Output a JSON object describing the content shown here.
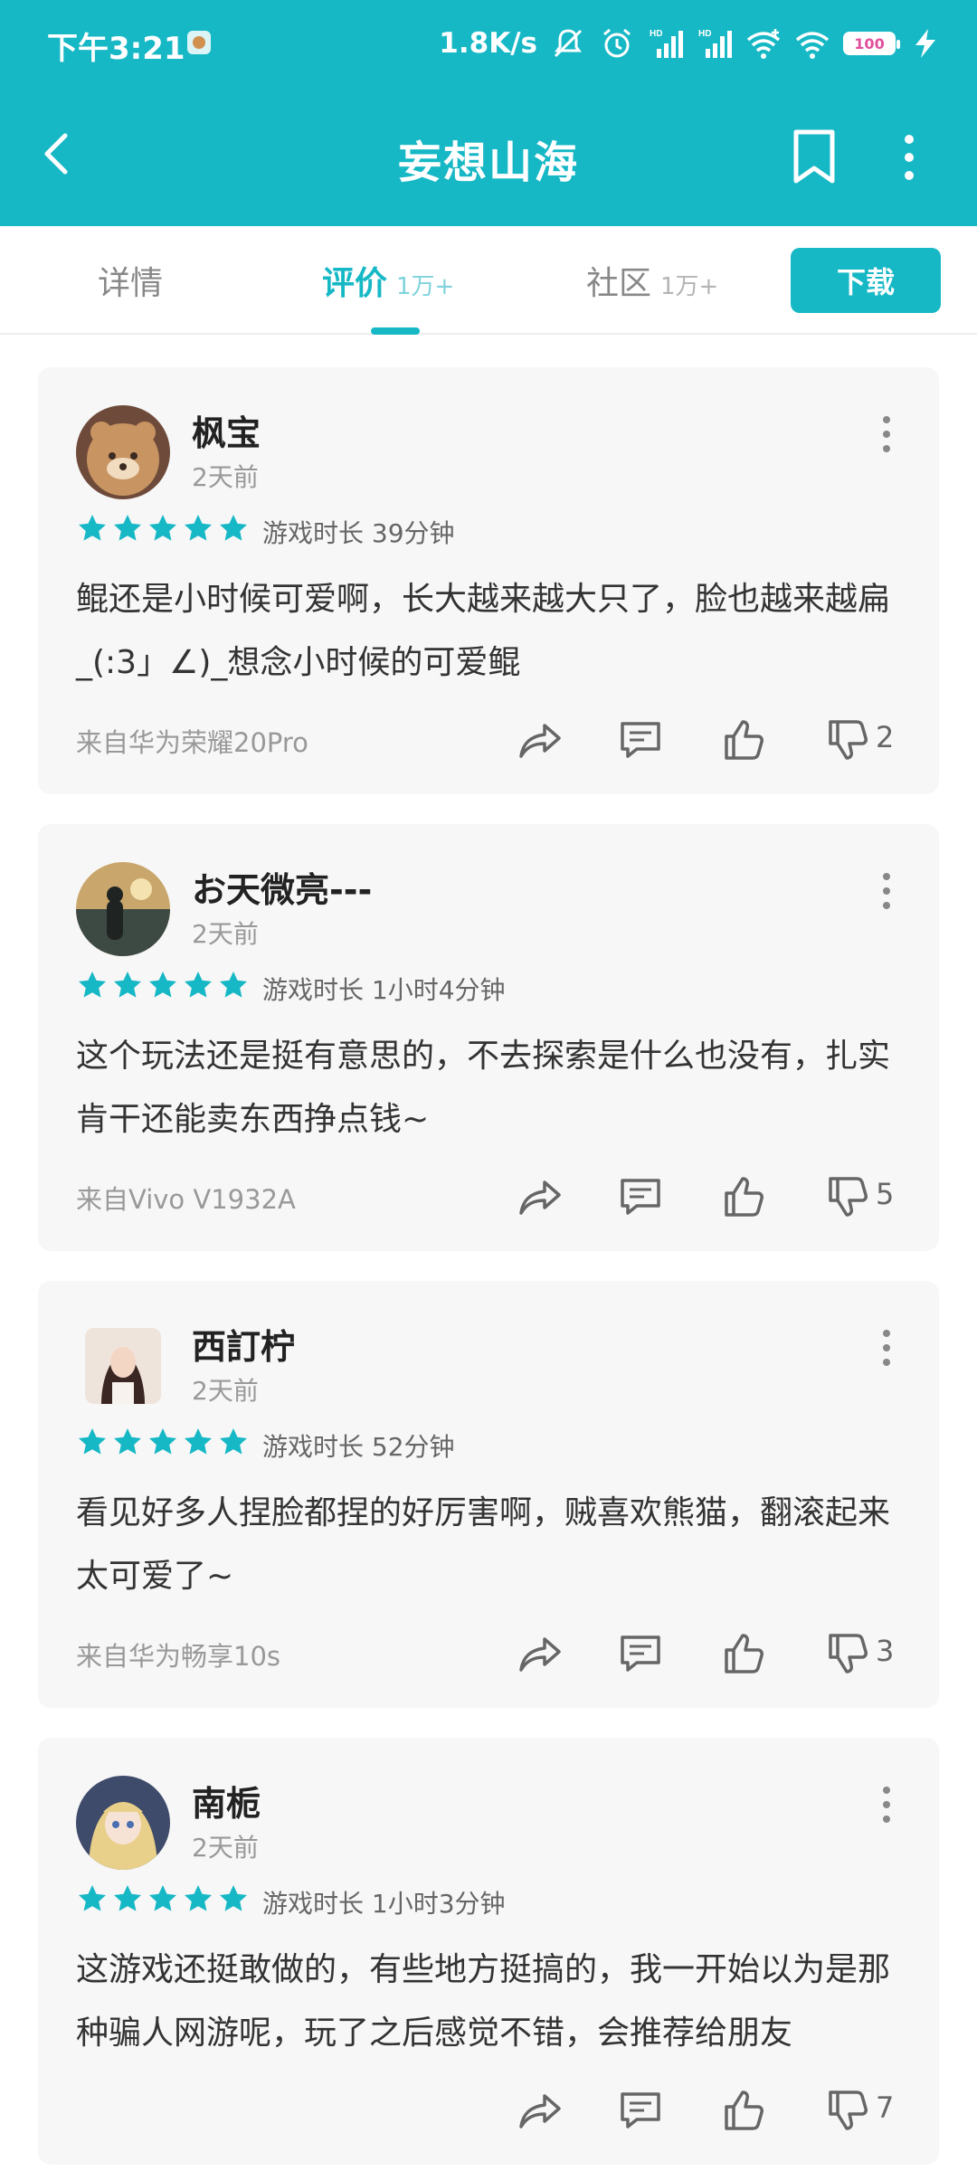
{
  "status_bar": {
    "time": "下午3:21",
    "net_speed": "1.8K/s",
    "battery": "100",
    "icons": [
      "mute-bell-icon",
      "alarm-icon",
      "hd-signal-icon",
      "hd-signal-icon",
      "wifi-plus-icon",
      "wifi-icon",
      "battery-icon",
      "charging-icon"
    ]
  },
  "header": {
    "title": "妄想山海",
    "icons": [
      "back-icon",
      "bookmark-icon",
      "more-vertical-icon"
    ]
  },
  "tabs": [
    {
      "label": "详情",
      "count": ""
    },
    {
      "label": "评价",
      "count": "1万+"
    },
    {
      "label": "社区",
      "count": "1万+"
    }
  ],
  "download_label": "下载",
  "colors": {
    "accent": "#17b8c6",
    "card_bg": "#f7f7f7"
  },
  "reviews": [
    {
      "user": "枫宝",
      "time": "2天前",
      "rating": 5,
      "playtime": "游戏时长 39分钟",
      "content": "鲲还是小时候可爱啊，长大越来越大只了，脸也越来越扁_(:3」∠)_想念小时候的可爱鲲",
      "device": "来自华为荣耀20Pro",
      "dislikes": "2"
    },
    {
      "user": "お天微亮---",
      "time": "2天前",
      "rating": 5,
      "playtime": "游戏时长 1小时4分钟",
      "content": "这个玩法还是挺有意思的，不去探索是什么也没有，扎实肯干还能卖东西挣点钱~",
      "device": "来自Vivo V1932A",
      "dislikes": "5"
    },
    {
      "user": "西訂柠",
      "time": "2天前",
      "rating": 5,
      "playtime": "游戏时长 52分钟",
      "content": "看见好多人捏脸都捏的好厉害啊，贼喜欢熊猫，翻滚起来太可爱了~",
      "device": "来自华为畅享10s",
      "dislikes": "3"
    },
    {
      "user": "南栀",
      "time": "2天前",
      "rating": 5,
      "playtime": "游戏时长 1小时3分钟",
      "content": "这游戏还挺敢做的，有些地方挺搞的，我一开始以为是那种骗人网游呢，玩了之后感觉不错，会推荐给朋友",
      "device": "",
      "dislikes": "7"
    }
  ]
}
